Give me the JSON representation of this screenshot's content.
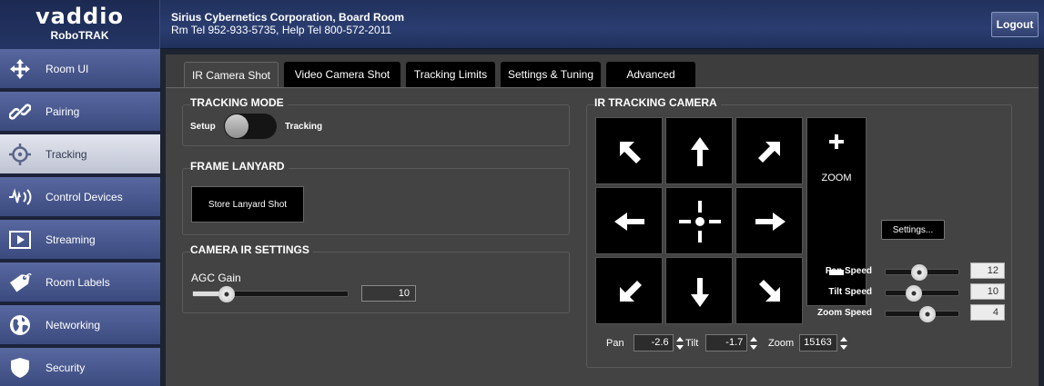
{
  "header": {
    "brand": "vaddio",
    "product": "RoboTRAK",
    "company": "Sirius Cybernetics Corporation, Board Room",
    "contact": "Rm Tel 952-933-5735, Help Tel 800-572-2011",
    "logout_label": "Logout"
  },
  "sidebar": {
    "items": [
      {
        "label": "Room UI",
        "icon": "move-arrows-icon"
      },
      {
        "label": "Pairing",
        "icon": "link-icon"
      },
      {
        "label": "Tracking",
        "icon": "target-icon",
        "active": true
      },
      {
        "label": "Control Devices",
        "icon": "signal-waves-icon"
      },
      {
        "label": "Streaming",
        "icon": "play-icon"
      },
      {
        "label": "Room Labels",
        "icon": "tag-icon"
      },
      {
        "label": "Networking",
        "icon": "globe-icon"
      },
      {
        "label": "Security",
        "icon": "shield-icon"
      }
    ]
  },
  "tabs": [
    "IR Camera Shot",
    "Video Camera Shot",
    "Tracking Limits",
    "Settings & Tuning",
    "Advanced"
  ],
  "active_tab": "IR Camera Shot",
  "tracking_mode": {
    "title": "TRACKING MODE",
    "left_label": "Setup",
    "right_label": "Tracking",
    "state": "Setup"
  },
  "frame_lanyard": {
    "title": "FRAME LANYARD",
    "button_label": "Store Lanyard Shot"
  },
  "camera_ir_settings": {
    "title": "CAMERA IR SETTINGS",
    "agc_label": "AGC Gain",
    "agc_value": "10",
    "agc_fraction": 0.22
  },
  "ir_tracking_camera": {
    "title": "IR TRACKING CAMERA",
    "zoom_label": "ZOOM",
    "settings_label": "Settings...",
    "pan_speed_label": "Pan Speed",
    "pan_speed_value": "12",
    "pan_speed_fraction": 0.46,
    "tilt_speed_label": "Tilt Speed",
    "tilt_speed_value": "10",
    "tilt_speed_fraction": 0.39,
    "zoom_speed_label": "Zoom Speed",
    "zoom_speed_value": "4",
    "zoom_speed_fraction": 0.57,
    "pan_label": "Pan",
    "pan_value": "-2.6",
    "tilt_label": "Tilt",
    "tilt_value": "-1.7",
    "zoom_field_label": "Zoom",
    "zoom_value": "15163"
  },
  "colors": {
    "header_bg": "#2a3d70",
    "nav_bg": "#4a5a90",
    "nav_active_bg": "#d4d8e4",
    "panel_bg": "#434343",
    "button_bg": "#000000"
  }
}
